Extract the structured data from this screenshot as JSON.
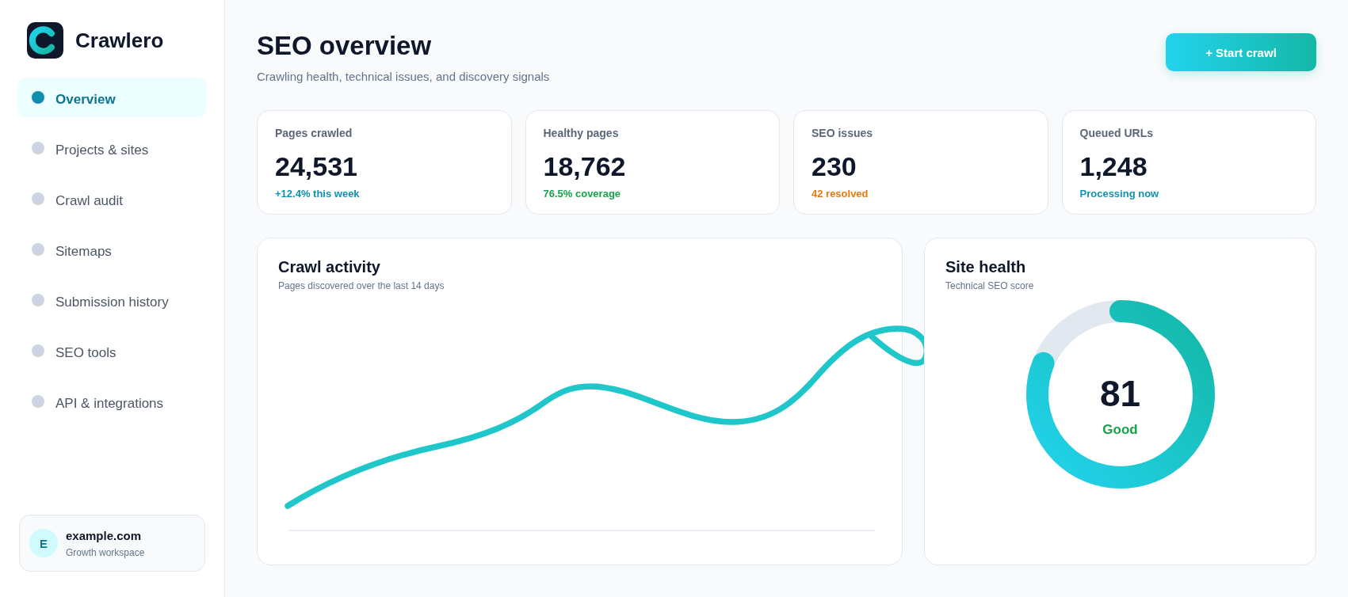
{
  "brand": {
    "name": "Crawlero"
  },
  "nav": [
    {
      "label": "Overview",
      "selected": true
    },
    {
      "label": "Projects & sites",
      "selected": false
    },
    {
      "label": "Crawl audit",
      "selected": false
    },
    {
      "label": "Sitemaps",
      "selected": false
    },
    {
      "label": "Submission history",
      "selected": false
    },
    {
      "label": "SEO tools",
      "selected": false
    },
    {
      "label": "API & integrations",
      "selected": false
    }
  ],
  "workspace": {
    "initial": "E",
    "name": "example.com",
    "plan": "Growth workspace"
  },
  "header": {
    "title": "SEO overview",
    "subtitle": "Crawling health, technical issues, and discovery signals",
    "action": "+ Start crawl"
  },
  "stats": [
    {
      "label": "Pages crawled",
      "value": "24,531",
      "note": "+12.4% this week",
      "color": "#0e91b2"
    },
    {
      "label": "Healthy pages",
      "value": "18,762",
      "note": "76.5% coverage",
      "color": "#16a34a"
    },
    {
      "label": "SEO issues",
      "value": "230",
      "note": "42 resolved",
      "color": "#e8780e"
    },
    {
      "label": "Queued URLs",
      "value": "1,248",
      "note": "Processing now",
      "color": "#0e91b2"
    }
  ],
  "crawl_activity": {
    "title": "Crawl activity",
    "subtitle": "Pages discovered over the last 14 days"
  },
  "site_health": {
    "title": "Site health",
    "subtitle": "Technical SEO score",
    "score": "81",
    "rating": "Good",
    "level": 0.81
  }
}
